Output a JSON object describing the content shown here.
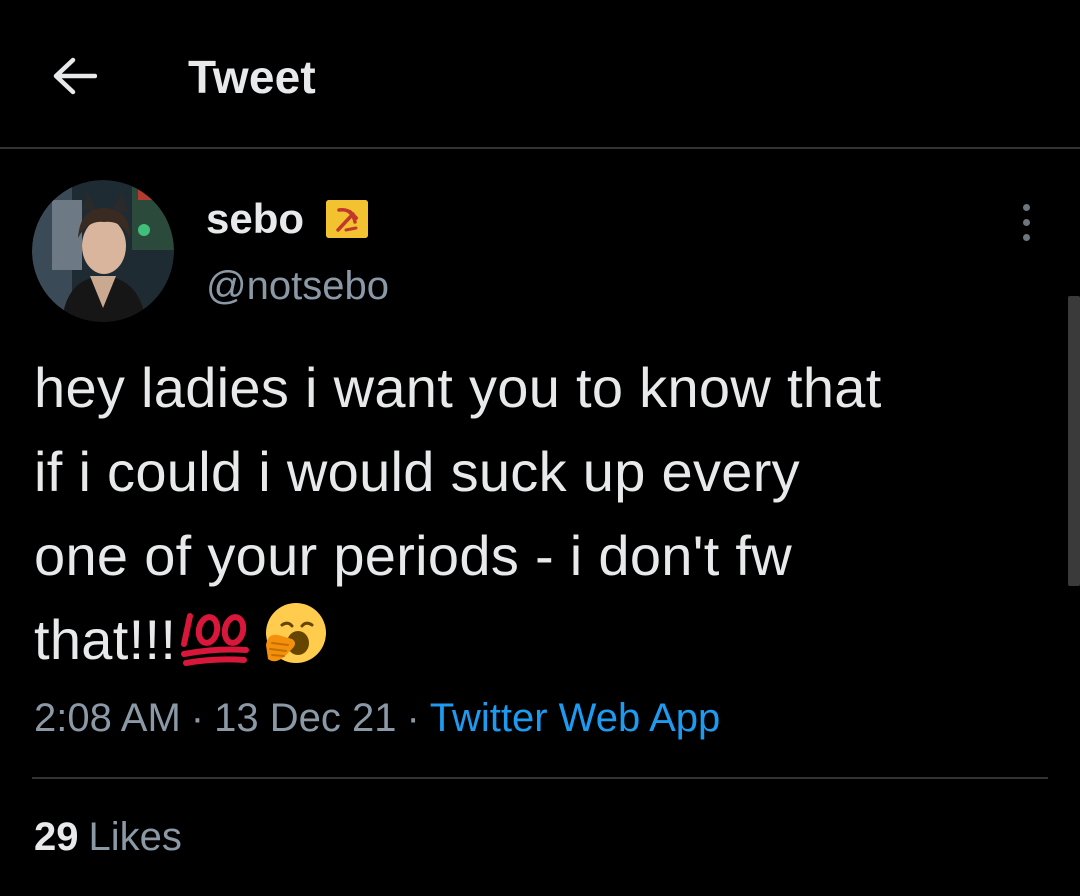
{
  "header": {
    "title": "Tweet",
    "back_icon": "arrow-left-icon"
  },
  "author": {
    "display_name": "sebo",
    "handle": "@notsebo",
    "badge_icon": "hammer-and-sickle-flag-icon"
  },
  "tweet": {
    "lines": [
      "hey ladies i want you to know that",
      "if i could i would suck up every",
      "one of your periods - i don't fw",
      "that!!!"
    ],
    "emojis": [
      "hundred-points-emoji",
      "yawning-face-emoji"
    ],
    "time": "2:08 AM",
    "date": "13 Dec 21",
    "separator": "·",
    "source": "Twitter Web App"
  },
  "stats": {
    "likes_count": "29",
    "likes_label": "Likes"
  },
  "colors": {
    "background": "#000000",
    "text": "#e7e9ea",
    "secondary": "#8b98a5",
    "link": "#1d9bf0",
    "divider": "#2f3336"
  }
}
